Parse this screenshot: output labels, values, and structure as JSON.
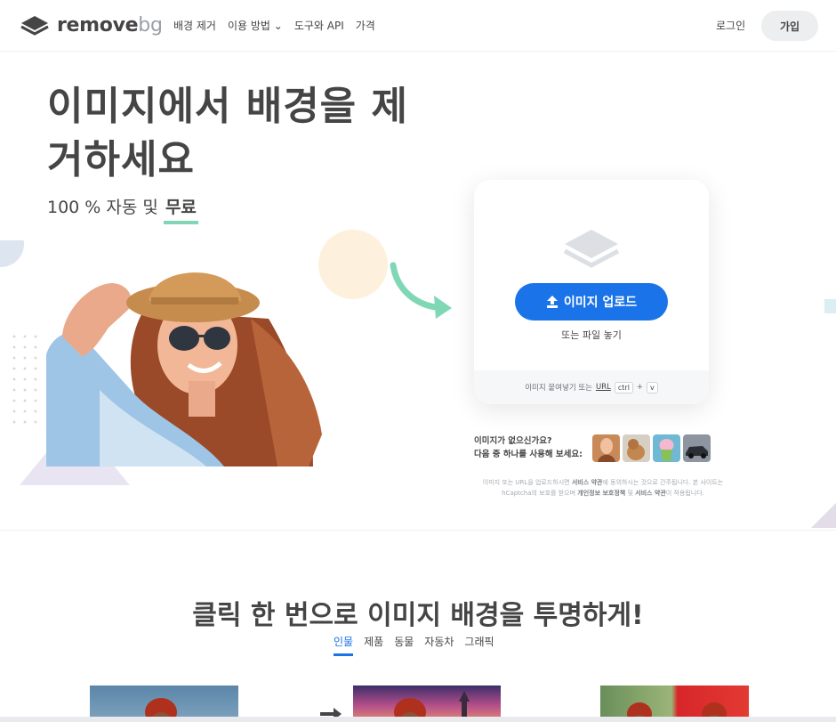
{
  "brand": {
    "name_main": "remove",
    "name_suffix": "bg"
  },
  "nav": {
    "links": [
      "배경 제거",
      "이용 방법",
      "도구와 API",
      "가격"
    ],
    "login": "로그인",
    "signup": "가입"
  },
  "hero": {
    "title_line1": "이미지에서 배경을 제",
    "title_line2": "거하세요",
    "sub_prefix": "100 % 자동 및",
    "sub_free": "무료"
  },
  "upload": {
    "button_label": "이미지 업로드",
    "drop_text": "또는 파일 놓기",
    "paste_text": "이미지 붙여넣기 또는",
    "url_text": "URL",
    "key_ctrl": "ctrl",
    "key_plus": "+",
    "key_v": "v"
  },
  "samples": {
    "line1": "이미지가 없으신가요?",
    "line2": "다음 중 하나를 사용해 보세요:",
    "items": [
      "sample-woman",
      "sample-dog",
      "sample-cupcake",
      "sample-car"
    ]
  },
  "terms": {
    "part1": "이미지 또는 URL을 업로드하시면 ",
    "tos": "서비스 약관",
    "part2": "에 동의하시는 것으로 간주됩니다. 본 사이트는 hCaptcha의 보호를 받으며 ",
    "privacy": "개인정보 보호정책",
    "part3": " 및 ",
    "tos2": "서비스 약관",
    "part4": "이 적용됩니다."
  },
  "section2": {
    "title": "클릭 한 번으로 이미지 배경을 투명하게!",
    "tabs": [
      "인물",
      "제품",
      "동물",
      "자동차",
      "그래픽"
    ],
    "active_tab": "인물"
  },
  "colors": {
    "accent": "#1a73e8",
    "underline": "#7fd7b6",
    "text": "#454545"
  }
}
